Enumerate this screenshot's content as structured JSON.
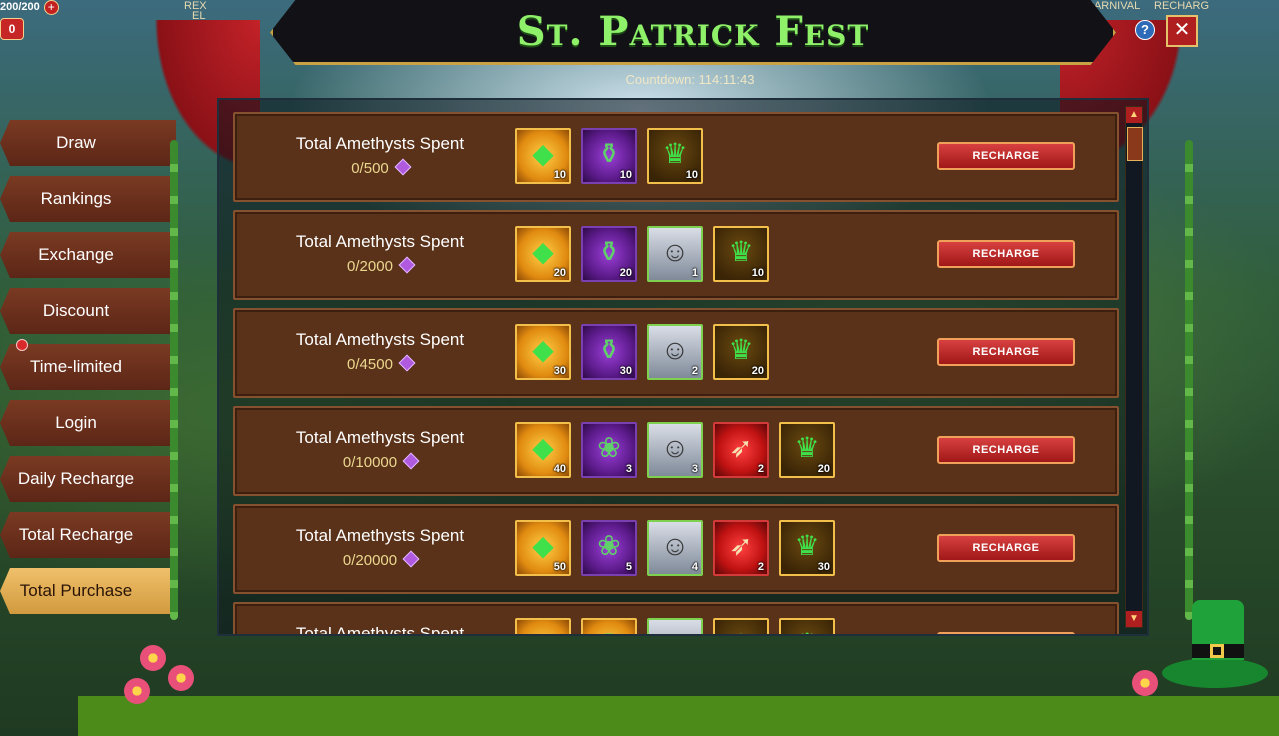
{
  "hud": {
    "stamina": "200/200",
    "plus_symbol": "+",
    "left_button_label": "0",
    "top_labels": [
      "REX",
      "EL",
      "CARNIVAL",
      "RECHARG"
    ]
  },
  "event": {
    "title": "St. Patrick Fest",
    "countdown": "Countdown: 114:11:43",
    "help_symbol": "?",
    "close_symbol": "✕"
  },
  "tabs": [
    {
      "label": "Draw",
      "active": false
    },
    {
      "label": "Rankings",
      "active": false
    },
    {
      "label": "Exchange",
      "active": false
    },
    {
      "label": "Discount",
      "active": false
    },
    {
      "label": "Time-limited",
      "active": false
    },
    {
      "label": "Login",
      "active": false
    },
    {
      "label": "Daily Recharge",
      "active": false
    },
    {
      "label": "Total Recharge",
      "active": false
    },
    {
      "label": "Total Purchase",
      "active": true
    }
  ],
  "tiers": [
    {
      "title": "Total Amethysts Spent",
      "progress": "0/500",
      "button": "RECHARGE",
      "rewards": [
        {
          "icon": "green-gem-icon",
          "style": "gold",
          "qty": "10"
        },
        {
          "icon": "potion-icon",
          "style": "purple",
          "qty": "10"
        },
        {
          "icon": "crystal-crown-icon",
          "style": "goldcrown",
          "qty": "10"
        }
      ]
    },
    {
      "title": "Total Amethysts Spent",
      "progress": "0/2000",
      "button": "RECHARGE",
      "rewards": [
        {
          "icon": "green-gem-icon",
          "style": "gold",
          "qty": "20"
        },
        {
          "icon": "potion-icon",
          "style": "purple",
          "qty": "20"
        },
        {
          "icon": "hero-portrait-icon",
          "style": "hero",
          "qty": "1"
        },
        {
          "icon": "crystal-crown-icon",
          "style": "goldcrown",
          "qty": "10"
        }
      ]
    },
    {
      "title": "Total Amethysts Spent",
      "progress": "0/4500",
      "button": "RECHARGE",
      "rewards": [
        {
          "icon": "green-gem-icon",
          "style": "gold",
          "qty": "30"
        },
        {
          "icon": "potion-icon",
          "style": "purple",
          "qty": "30"
        },
        {
          "icon": "hero-portrait-icon",
          "style": "hero",
          "qty": "2"
        },
        {
          "icon": "crystal-crown-icon",
          "style": "goldcrown",
          "qty": "20"
        }
      ]
    },
    {
      "title": "Total Amethysts Spent",
      "progress": "0/10000",
      "button": "RECHARGE",
      "rewards": [
        {
          "icon": "green-gem-icon",
          "style": "gold",
          "qty": "40"
        },
        {
          "icon": "blue-flower-icon",
          "style": "purple",
          "qty": "3"
        },
        {
          "icon": "hero-portrait-icon",
          "style": "hero",
          "qty": "3"
        },
        {
          "icon": "horn-icon",
          "style": "red",
          "qty": "2"
        },
        {
          "icon": "crystal-crown-icon",
          "style": "goldcrown",
          "qty": "20"
        }
      ]
    },
    {
      "title": "Total Amethysts Spent",
      "progress": "0/20000",
      "button": "RECHARGE",
      "rewards": [
        {
          "icon": "green-gem-icon",
          "style": "gold",
          "qty": "50"
        },
        {
          "icon": "blue-flower-icon",
          "style": "purple",
          "qty": "5"
        },
        {
          "icon": "hero-portrait-icon",
          "style": "hero",
          "qty": "4"
        },
        {
          "icon": "horn-icon",
          "style": "red",
          "qty": "2"
        },
        {
          "icon": "crystal-crown-icon",
          "style": "goldcrown",
          "qty": "30"
        }
      ]
    },
    {
      "title": "Total Amethysts Spent",
      "progress": "",
      "button": "RECHARGE",
      "rewards": [
        {
          "icon": "green-gem-icon",
          "style": "gold",
          "qty": ""
        },
        {
          "icon": "potion-icon",
          "style": "gold",
          "qty": ""
        },
        {
          "icon": "hero-portrait-icon",
          "style": "hero",
          "qty": ""
        },
        {
          "icon": "ssr-icon",
          "style": "goldcrown",
          "qty": ""
        },
        {
          "icon": "crystal-crown-icon",
          "style": "goldcrown",
          "qty": ""
        }
      ]
    }
  ],
  "glyphs": {
    "green-gem-icon": "◆",
    "potion-icon": "⚱",
    "crystal-crown-icon": "♛",
    "hero-portrait-icon": "☺",
    "blue-flower-icon": "❀",
    "horn-icon": "➶",
    "ssr-icon": "★"
  },
  "colors": {
    "title_green": "#8ff06a",
    "row_brown": "#5a3119",
    "button_red": "#c32020",
    "gold_border": "#f2c04a"
  }
}
